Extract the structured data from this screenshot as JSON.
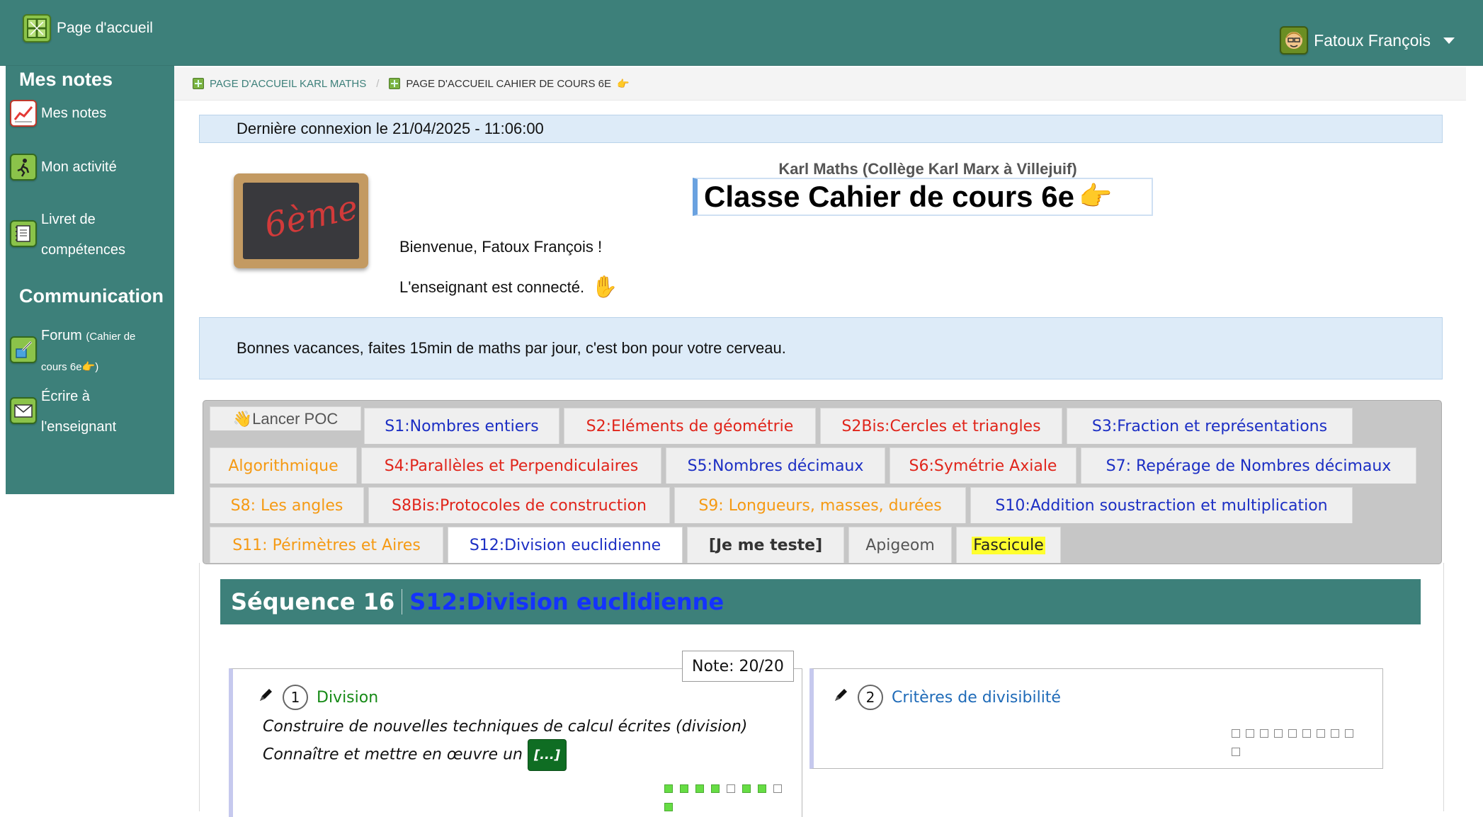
{
  "topbar": {
    "home_label": "Page d'accueil",
    "user_name": "Fatoux François"
  },
  "sidebar": {
    "heading_notes": "Mes notes",
    "mes_notes": "Mes notes",
    "activite": "Mon activité",
    "livret_1": "Livret de",
    "livret_2": "compétences",
    "heading_communication": "Communication",
    "forum_1": "Forum",
    "forum_small_1": "(Cahier de",
    "forum_small_2": "cours 6e",
    "forum_small_3": ")",
    "ecrire_1": "Écrire à",
    "ecrire_2": "l'enseignant"
  },
  "breadcrumb": {
    "item1": "Page d'accueil Karl Maths",
    "item2": "Page d'accueil Cahier de cours 6e"
  },
  "last_connection": "Dernière connexion le 21/04/2025 - 11:06:00",
  "slate_text": "6ème",
  "school": "Karl Maths (Collège Karl Marx à Villejuif)",
  "class_title": "Classe Cahier de cours 6e",
  "welcome": "Bienvenue, Fatoux François !",
  "teacher_status": "L'enseignant est connecté.",
  "announcement": "Bonnes vacances, faites 15min de maths par jour, c'est bon pour votre cerveau.",
  "tabs": {
    "poc": "Lancer POC",
    "s1": "S1:Nombres entiers",
    "s2": "S2:Eléments de géométrie",
    "s2bis": "S2Bis:Cercles et triangles",
    "s3": "S3:Fraction et représentations",
    "algo": "Algorithmique",
    "s4": "S4:Parallèles et Perpendiculaires",
    "s5": "S5:Nombres décimaux",
    "s6": "S6:Symétrie Axiale",
    "s7": "S7: Repérage de Nombres décimaux",
    "s8": "S8: Les angles",
    "s8bis": "S8Bis:Protocoles de construction",
    "s9": "S9: Longueurs, masses, durées",
    "s10": "S10:Addition soustraction et multiplication",
    "s11": "S11: Périmètres et Aires",
    "s12": "S12:Division euclidienne",
    "test": "[Je me teste]",
    "apigeom": "Apigeom",
    "fascicule": "Fascicule"
  },
  "sequence": {
    "label": "Séquence 16",
    "title": "S12:Division euclidienne"
  },
  "card1": {
    "note": "Note: 20/20",
    "number": "1",
    "title": "Division",
    "line1": "Construire de nouvelles techniques de calcul écrites (division)",
    "line2": "Connaître et mettre en œuvre un",
    "more": "[...]",
    "progress": [
      1,
      1,
      1,
      1,
      0,
      1,
      1,
      0,
      1
    ]
  },
  "card2": {
    "number": "2",
    "title": "Critères de divisibilité",
    "progress": [
      0,
      0,
      0,
      0,
      0,
      0,
      0,
      0,
      0,
      0
    ]
  },
  "colors": {
    "teal": "#3d807a",
    "info_bg": "#ddebf8",
    "link_blue": "#1c2fc4",
    "link_red": "#e0251b",
    "link_orange": "#f59a14"
  }
}
